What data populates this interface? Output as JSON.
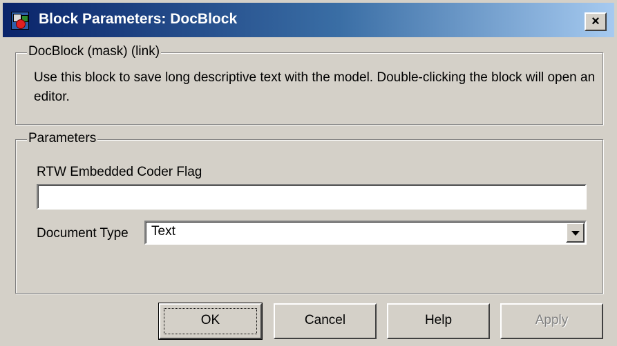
{
  "window": {
    "title": "Block Parameters: DocBlock",
    "close_label": "×"
  },
  "description_group": {
    "legend": "DocBlock (mask) (link)",
    "text": "Use this block to save long descriptive text with the model.  Double-clicking the block will open an editor."
  },
  "parameters_group": {
    "legend": "Parameters",
    "rtw_label": "RTW Embedded Coder Flag",
    "rtw_value": "",
    "doctype_label": "Document Type",
    "doctype_value": "Text"
  },
  "buttons": {
    "ok": "OK",
    "cancel": "Cancel",
    "help": "Help",
    "apply": "Apply"
  },
  "colors": {
    "titlebar_start": "#0a246a",
    "titlebar_end": "#a6caf0",
    "dialog_face": "#d4d0c8"
  }
}
